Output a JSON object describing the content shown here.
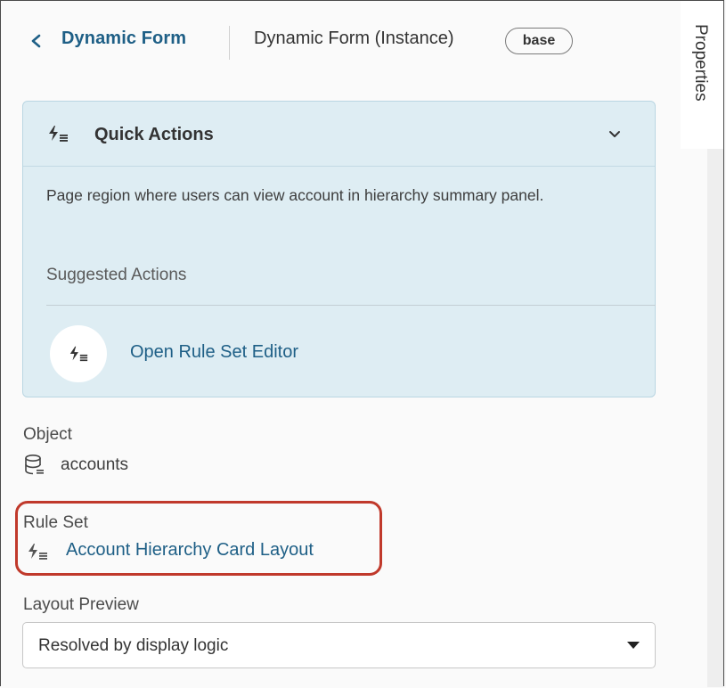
{
  "header": {
    "back_label": "Dynamic Form",
    "instance_title": "Dynamic Form (Instance)",
    "badge": "base"
  },
  "quick_actions": {
    "title": "Quick Actions",
    "description": "Page region where users can view account in hierarchy summary panel.",
    "suggested_label": "Suggested Actions",
    "action_label": "Open Rule Set Editor",
    "icon": "rule-set-icon",
    "expanded": true
  },
  "object": {
    "label": "Object",
    "value": "accounts",
    "icon": "database-icon"
  },
  "rule_set": {
    "label": "Rule Set",
    "value": "Account Hierarchy Card Layout",
    "icon": "rule-set-icon"
  },
  "layout_preview": {
    "label": "Layout Preview",
    "selected": "Resolved by display logic"
  },
  "side_tab": {
    "label": "Properties"
  },
  "colors": {
    "link": "#1e5f86",
    "card_bg": "#deedf3",
    "highlight": "#c0392b"
  }
}
